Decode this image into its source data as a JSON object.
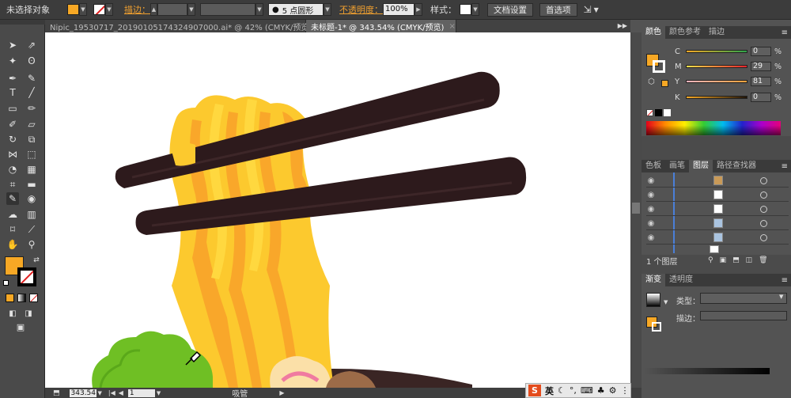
{
  "control_bar": {
    "no_selection": "未选择对象",
    "stroke_label": "描边：",
    "brush_label": "5 点圆形",
    "opacity_label": "不透明度：",
    "opacity_value": "100%",
    "style_label": "样式：",
    "doc_setup": "文档设置",
    "preferences": "首选项",
    "fill_color": "#f7a825"
  },
  "tabs": [
    {
      "label": "Nipic_19530717_20190105174324907000.ai* @ 42% (CMYK/预览)",
      "close": "×"
    },
    {
      "label": "未标题-1* @ 343.54% (CMYK/预览)",
      "close": "×"
    }
  ],
  "color_panel": {
    "tabs": [
      "颜色",
      "颜色参考",
      "描边"
    ],
    "channels": [
      {
        "label": "C",
        "value": "0"
      },
      {
        "label": "M",
        "value": "29"
      },
      {
        "label": "Y",
        "value": "81"
      },
      {
        "label": "K",
        "value": "0"
      }
    ],
    "pct": "%"
  },
  "layers_panel": {
    "tabs": [
      "色板",
      "画笔",
      "图层",
      "路径查找器"
    ],
    "layer_count": "1 个图层"
  },
  "gradient_panel": {
    "tabs": [
      "渐变",
      "透明度"
    ],
    "type_label": "类型：",
    "stroke_label": "描边："
  },
  "status_bar": {
    "zoom": "343.54",
    "page": "1",
    "tool": "吸管"
  },
  "taskbar": {
    "ime": "英"
  }
}
